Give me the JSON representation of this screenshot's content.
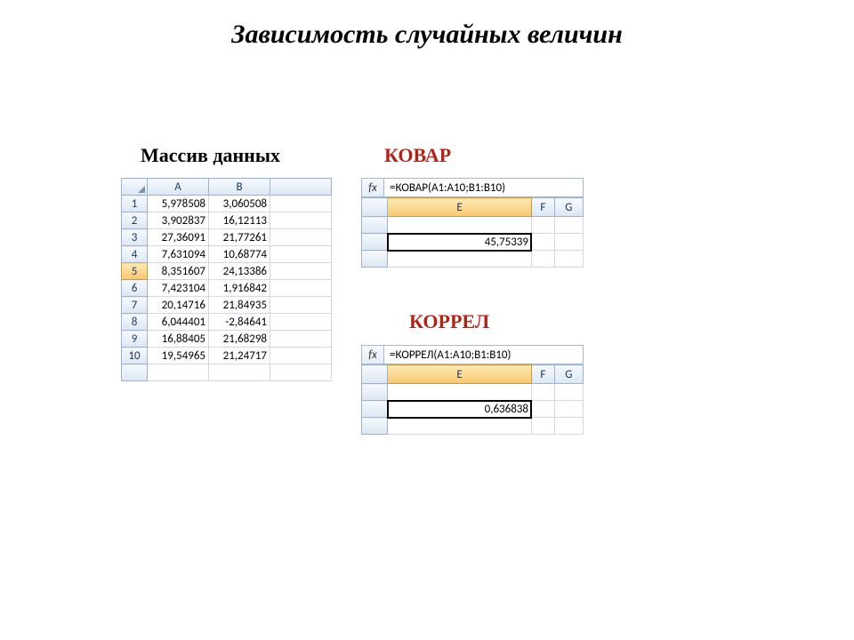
{
  "title": "Зависимость случайных величин",
  "labels": {
    "data": "Массив данных",
    "kovar": "КОВАР",
    "korrel": "КОРРЕЛ"
  },
  "data_table": {
    "cols": [
      "A",
      "B"
    ],
    "rows": [
      {
        "n": "1",
        "a": "5,978508",
        "b": "3,060508"
      },
      {
        "n": "2",
        "a": "3,902837",
        "b": "16,12113"
      },
      {
        "n": "3",
        "a": "27,36091",
        "b": "21,77261"
      },
      {
        "n": "4",
        "a": "7,631094",
        "b": "10,68774"
      },
      {
        "n": "5",
        "a": "8,351607",
        "b": "24,13386"
      },
      {
        "n": "6",
        "a": "7,423104",
        "b": "1,916842"
      },
      {
        "n": "7",
        "a": "20,14716",
        "b": "21,84935"
      },
      {
        "n": "8",
        "a": "6,044401",
        "b": "-2,84641"
      },
      {
        "n": "9",
        "a": "16,88405",
        "b": "21,68298"
      },
      {
        "n": "10",
        "a": "19,54965",
        "b": "21,24717"
      }
    ],
    "selected_row": 5
  },
  "kovar": {
    "fx_label": "fx",
    "formula": "=КОВАР(A1:A10;B1:B10)",
    "cols": [
      "E",
      "F",
      "G"
    ],
    "result": "45,75339"
  },
  "korrel": {
    "fx_label": "fx",
    "formula": "=КОРРЕЛ(A1:A10;B1:B10)",
    "cols": [
      "E",
      "F",
      "G"
    ],
    "result": "0,636838"
  }
}
